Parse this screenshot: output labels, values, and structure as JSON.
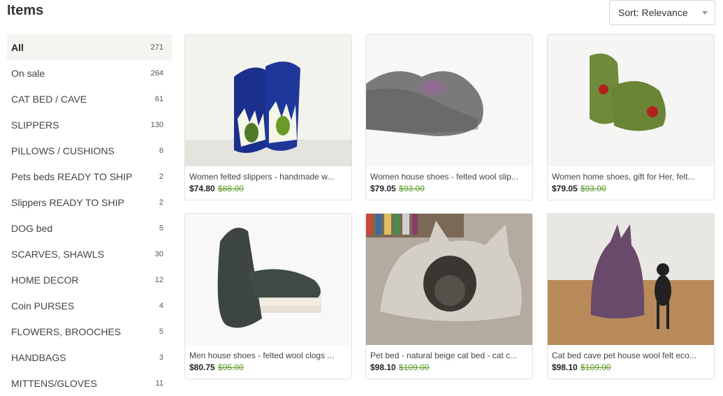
{
  "header": {
    "title": "Items",
    "sort_label": "Sort: Relevance"
  },
  "categories": [
    {
      "label": "All",
      "count": "271"
    },
    {
      "label": "On sale",
      "count": "264"
    },
    {
      "label": "CAT BED / CAVE",
      "count": "61"
    },
    {
      "label": "SLIPPERS",
      "count": "130"
    },
    {
      "label": "PILLOWS / CUSHIONS",
      "count": "6"
    },
    {
      "label": "Pets beds READY TO SHIP",
      "count": "2"
    },
    {
      "label": "Slippers READY TO SHIP",
      "count": "2"
    },
    {
      "label": "DOG bed",
      "count": "5"
    },
    {
      "label": "SCARVES, SHAWLS",
      "count": "30"
    },
    {
      "label": "HOME DECOR",
      "count": "12"
    },
    {
      "label": "Coin PURSES",
      "count": "4"
    },
    {
      "label": "FLOWERS, BROOCHES",
      "count": "5"
    },
    {
      "label": "HANDBAGS",
      "count": "3"
    },
    {
      "label": "MITTENS/GLOVES",
      "count": "11"
    }
  ],
  "items": [
    {
      "name": "Women felted slippers - handmade w...",
      "price": "$74.80",
      "old_price": "$88.00",
      "image": "blue-felt-slippers-photo"
    },
    {
      "name": "Women house shoes - felted wool slip...",
      "price": "$79.05",
      "old_price": "$93.00",
      "image": "gray-felt-shoe-photo"
    },
    {
      "name": "Women home shoes, gift for Her, felt...",
      "price": "$79.05",
      "old_price": "$93.00",
      "image": "green-felt-shoes-photo"
    },
    {
      "name": "Men house shoes - felted wool clogs ...",
      "price": "$80.75",
      "old_price": "$95.00",
      "image": "dark-clogs-on-books-photo"
    },
    {
      "name": "Pet bed - natural beige cat bed - cat c...",
      "price": "$98.10",
      "old_price": "$109.00",
      "image": "beige-cat-cave-photo"
    },
    {
      "name": "Cat bed cave pet house wool felt eco...",
      "price": "$98.10",
      "old_price": "$109.00",
      "image": "purple-cat-cave-photo"
    }
  ],
  "colors": {
    "sale_price": "#5a9a2a",
    "active_bg": "#f4f4f1"
  }
}
